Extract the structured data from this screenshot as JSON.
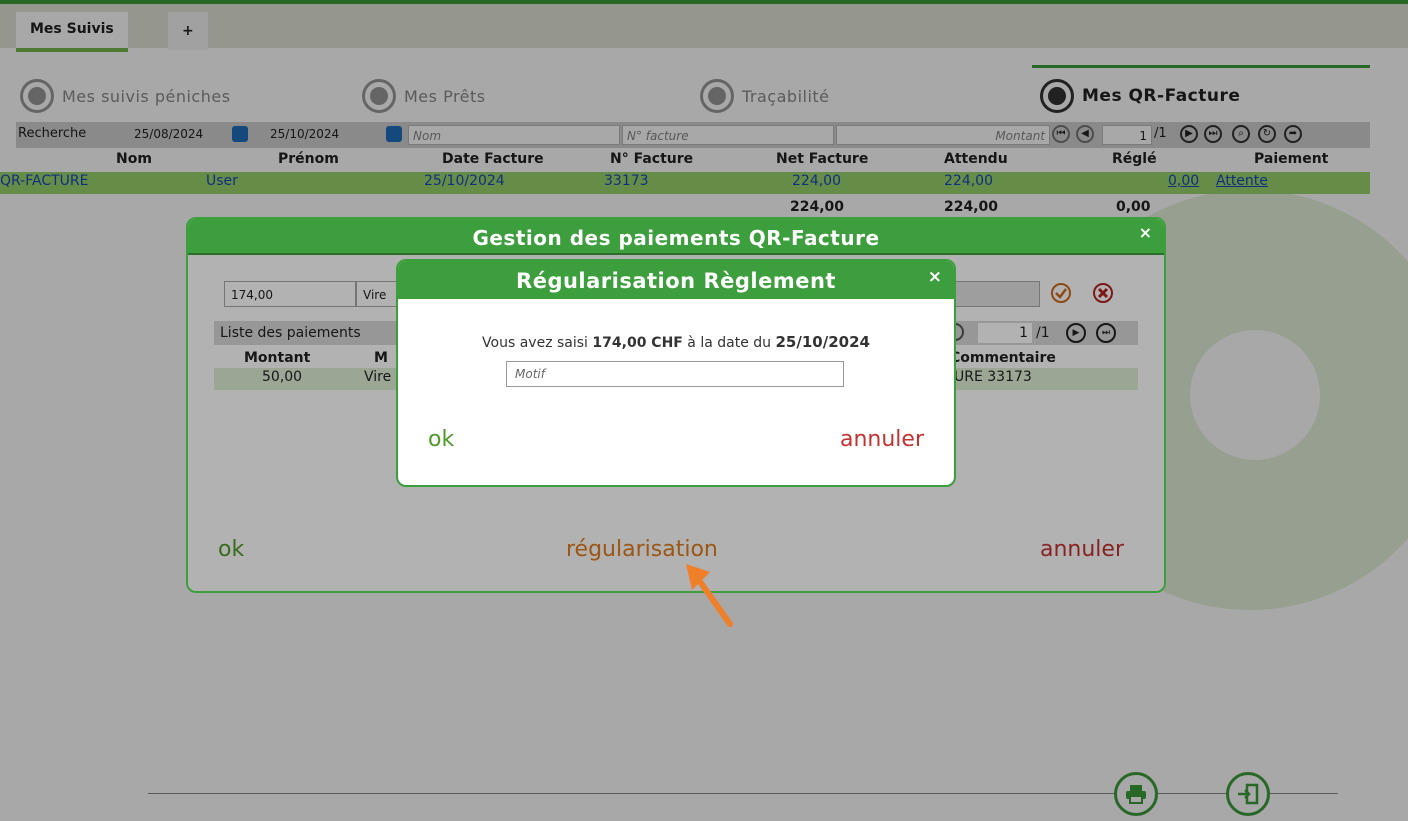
{
  "tabs": {
    "active": "Mes Suivis",
    "add": "+"
  },
  "nav": {
    "items": [
      "Mes suivis péniches",
      "Mes Prêts",
      "Traçabilité"
    ],
    "active": "Mes QR-Facture"
  },
  "search": {
    "label": "Recherche",
    "date_from": "25/08/2024",
    "date_to": "25/10/2024",
    "nom_placeholder": "Nom",
    "facture_placeholder": "N° facture",
    "montant_placeholder": "Montant",
    "page_current": "1",
    "page_total": "/1"
  },
  "table": {
    "headers": [
      "Nom",
      "Prénom",
      "Date Facture",
      "N° Facture",
      "Net Facture",
      "Attendu",
      "Réglé",
      "Paiement"
    ],
    "row": {
      "nom": "QR-FACTURE",
      "prenom": "User",
      "date": "25/10/2024",
      "numero": "33173",
      "net": "224,00",
      "attendu": "224,00",
      "regle": "0,00",
      "paiement": "Attente"
    },
    "totals": {
      "net": "224,00",
      "attendu": "224,00",
      "regle": "0,00"
    }
  },
  "dialog_paiements": {
    "title": "Gestion des paiements QR-Facture",
    "close": "×",
    "amount_value": "174,00",
    "mode_value": "Vire",
    "list_label": "Liste des paiements",
    "page_current": "1",
    "page_total": "/1",
    "col_montant": "Montant",
    "col_mode": "M",
    "col_commentaire": "Commentaire",
    "row_montant": "50,00",
    "row_mode": "Vire",
    "row_commentaire": "URE 33173",
    "ok": "ok",
    "regularisation": "régularisation",
    "annuler": "annuler"
  },
  "dialog_regularisation": {
    "title": "Régularisation Règlement",
    "close": "×",
    "msg_prefix": "Vous avez saisi ",
    "msg_amount": "174,00 CHF",
    "msg_middle": " à la date du ",
    "msg_date": "25/10/2024",
    "motif_placeholder": "Motif",
    "ok": "ok",
    "annuler": "annuler"
  },
  "colors": {
    "accent": "#3c9e3c",
    "ok": "#4f9a2a",
    "cancel": "#c43232",
    "regularisation": "#e07b1f",
    "arrow": "#f07f2a"
  },
  "icons": [
    "calendar-icon",
    "first-page-icon",
    "prev-page-icon",
    "next-page-icon",
    "last-page-icon",
    "search-icon",
    "refresh-icon",
    "export-icon",
    "check-icon",
    "close-circle-icon",
    "print-icon",
    "exit-icon"
  ]
}
